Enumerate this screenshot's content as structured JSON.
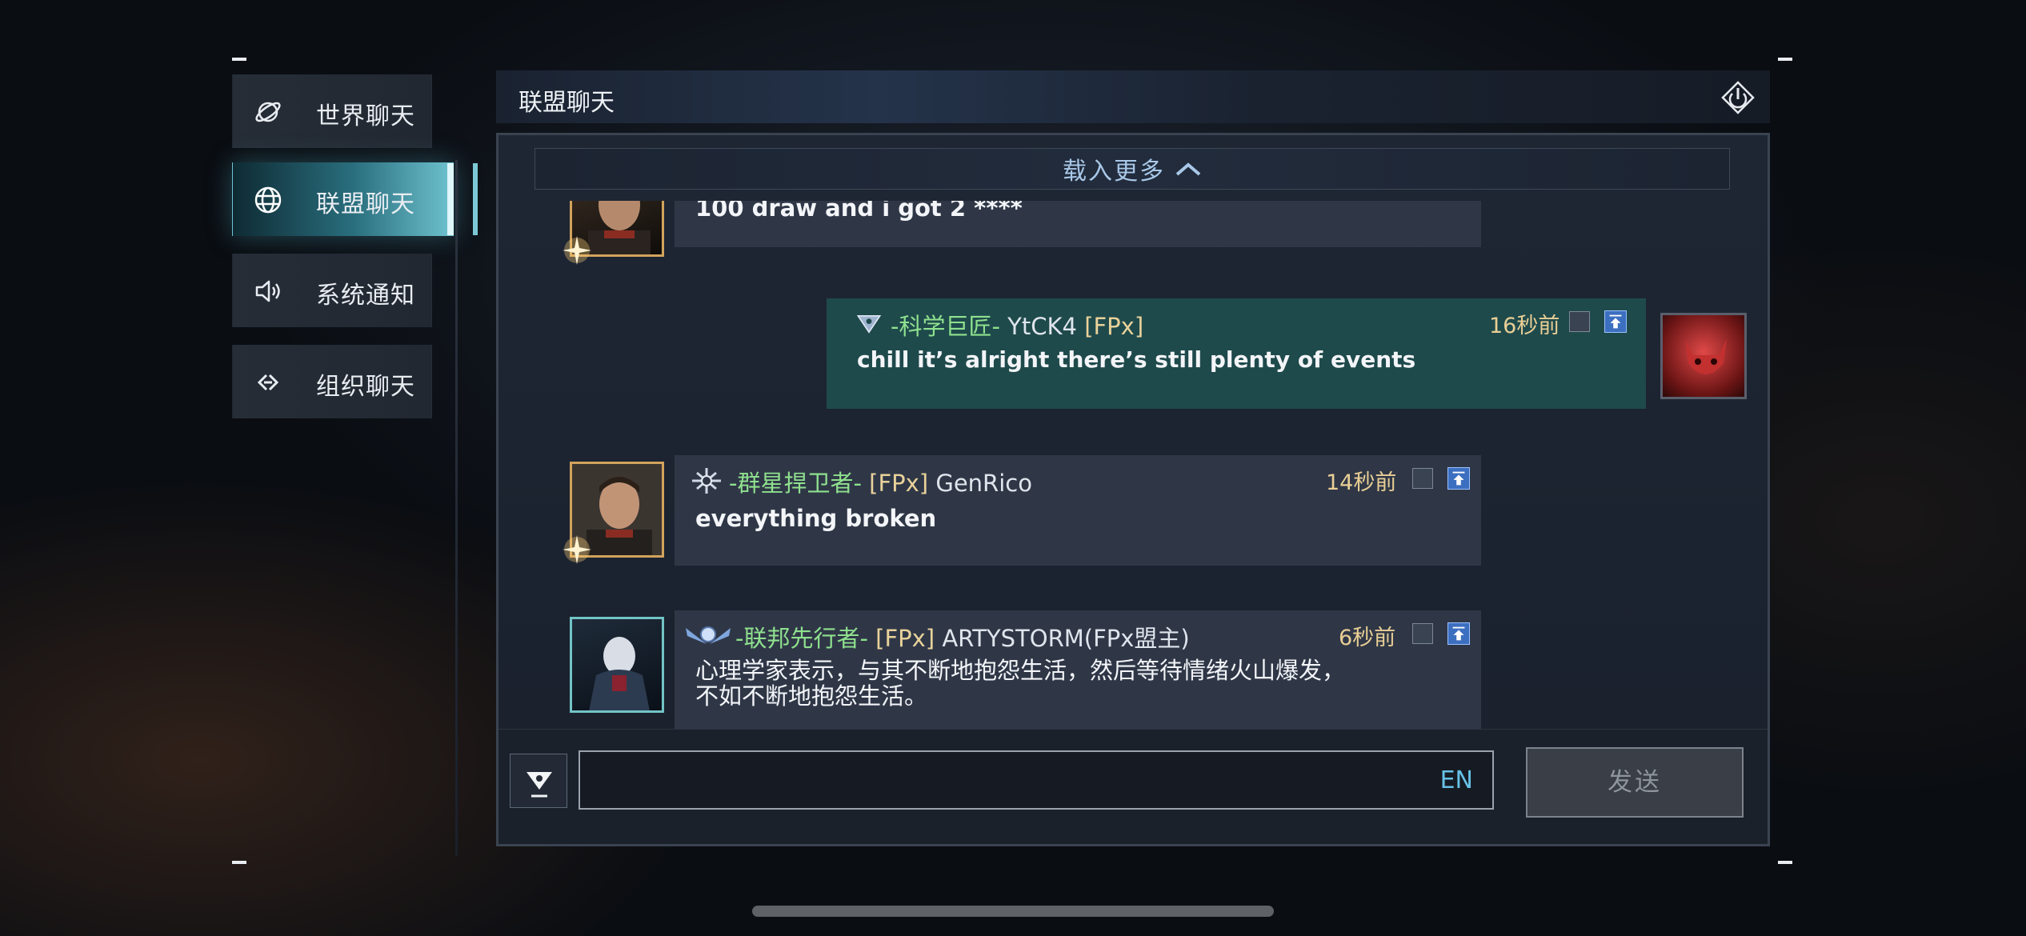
{
  "sidebar": {
    "items": [
      {
        "label": "世界聊天",
        "icon": "planet-icon",
        "active": false
      },
      {
        "label": "联盟聊天",
        "icon": "globe-icon",
        "active": true
      },
      {
        "label": "系统通知",
        "icon": "speaker-icon",
        "active": false
      },
      {
        "label": "组织聊天",
        "icon": "link-icon",
        "active": false
      }
    ]
  },
  "header": {
    "title": "联盟聊天",
    "icon": "power-icon"
  },
  "load_more": {
    "label": "载入更多"
  },
  "messages": [
    {
      "text": "100 draw and i got 2 ****",
      "avatar": "commander-portrait"
    },
    {
      "rank": "-科学巨匠-",
      "name": "YtCK4",
      "alliance": "[FPx]",
      "time": "16秒前",
      "text": "chill it’s alright there’s still plenty of events",
      "avatar": "red-cat-portrait"
    },
    {
      "rank": "-群星捍卫者-",
      "alliance": "[FPx]",
      "name": "GenRico",
      "time": "14秒前",
      "text": "everything broken",
      "avatar": "commander-portrait"
    },
    {
      "rank": "-联邦先行者-",
      "alliance": "[FPx]",
      "name": "ARTYSTORM(FPx盟主)",
      "time": "6秒前",
      "text_line1": "心理学家表示，与其不断地抱怨生活，然后等待情绪火山爆发，",
      "text_line2": "不如不断地抱怨生活。",
      "avatar": "hooded-portrait"
    }
  ],
  "input": {
    "lang": "EN",
    "placeholder": ""
  },
  "send": {
    "label": "发送"
  },
  "colors": {
    "accent": "#6fc3d0",
    "rank_green": "#8fe18e",
    "time_gold": "#e9cf95",
    "self_bubble": "#1f4a4c"
  }
}
